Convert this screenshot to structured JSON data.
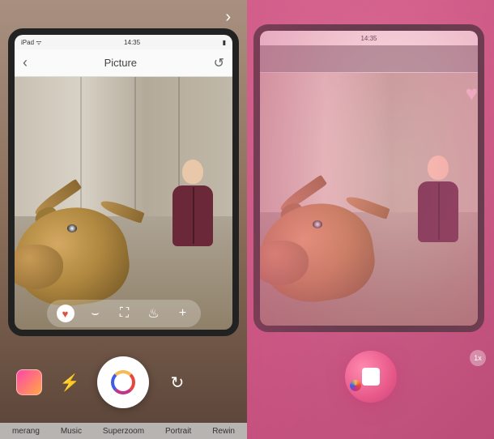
{
  "left": {
    "statusbar": {
      "carrier": "iPad ᯤ",
      "time": "14:35",
      "battery": "▮"
    },
    "header": {
      "title": "Picture"
    },
    "effects": {
      "heart": "♥",
      "surprise": "⌣",
      "frame": "⛶",
      "fire": "♨",
      "plus": "+"
    },
    "controls": {
      "flash": "⚡",
      "switch": "↻"
    },
    "modes": [
      "merang",
      "Music",
      "Superzoom",
      "Portrait",
      "Rewin"
    ],
    "top_arrow": "›"
  },
  "right": {
    "statusbar": {
      "time": "14:35"
    },
    "filter_heart": "♥",
    "filter_badge": "1x"
  }
}
